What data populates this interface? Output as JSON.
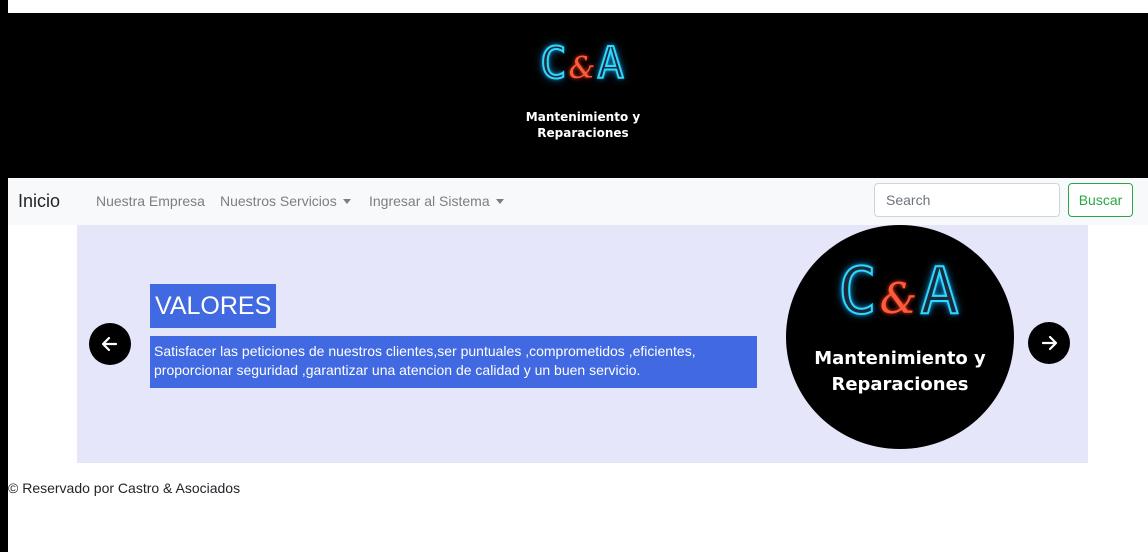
{
  "header": {
    "logo": {
      "left_letter": "C",
      "ampersand": "&",
      "right_letter": "A",
      "tagline": "Mantenimiento y Reparaciones"
    }
  },
  "navbar": {
    "brand": "Inicio",
    "links": [
      {
        "label": "Nuestra Empresa"
      },
      {
        "label": "Nuestros Servicios",
        "dropdown": true
      },
      {
        "label": "Ingresar al Sistema",
        "dropdown": true
      }
    ],
    "search": {
      "placeholder": "Search",
      "value": ""
    },
    "search_button": "Buscar"
  },
  "carousel": {
    "title": "VALORES",
    "text": "Satisfacer las peticiones de nuestros clientes,ser puntuales ,comprometidos ,eficientes, proporcionar seguridad ,garantizar una atencion de calidad y un buen servicio.",
    "prev_icon": "arrow-left-icon",
    "next_icon": "arrow-right-icon",
    "logo": {
      "left_letter": "C",
      "ampersand": "&",
      "right_letter": "A",
      "tagline": "Mantenimiento y Reparaciones"
    }
  },
  "footer": {
    "text": "© Reservado por Castro & Asociados"
  },
  "colors": {
    "neon_blue": "#2fd7ff",
    "neon_red": "#ff5a3a",
    "slide_bg": "#e6e6fa",
    "caption_bg": "#4169e1",
    "button_green": "#28a745"
  }
}
